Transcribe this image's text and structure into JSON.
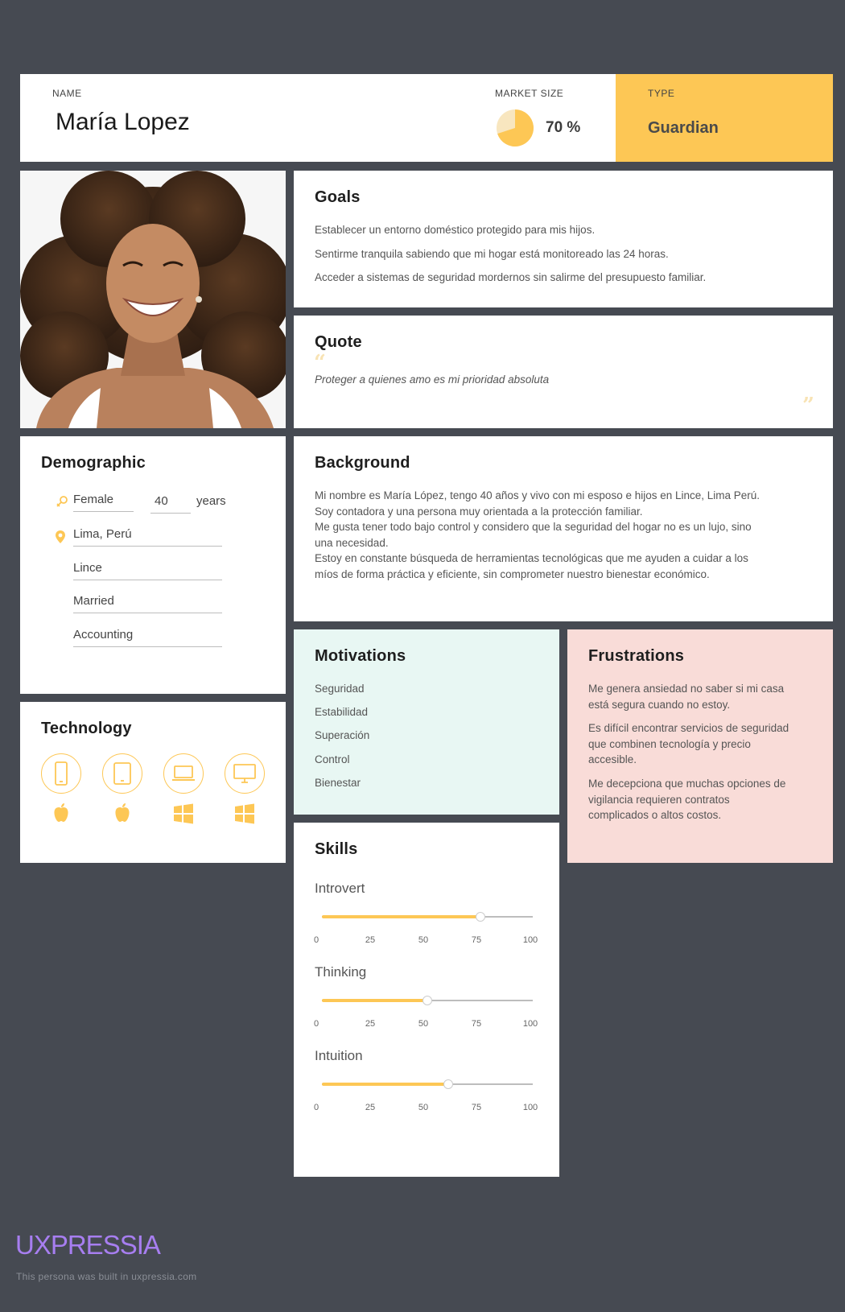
{
  "header": {
    "name_label": "NAME",
    "name": "María Lopez",
    "market_label": "MARKET SIZE",
    "market_value": "70 %",
    "market_fraction": 0.7,
    "type_label": "TYPE",
    "type_value": "Guardian"
  },
  "goals": {
    "title": "Goals",
    "items": [
      "Establecer un entorno doméstico protegido para mis hijos.",
      "Sentirme tranquila sabiendo que mi hogar está monitoreado las 24 horas.",
      "Acceder a sistemas de seguridad mordernos sin salirme del presupuesto familiar."
    ]
  },
  "quote": {
    "title": "Quote",
    "text": "Proteger a quienes amo es mi prioridad absoluta"
  },
  "demographic": {
    "title": "Demographic",
    "gender": "Female",
    "age": "40",
    "age_unit": "years",
    "location": "Lima, Perú",
    "district": "Lince",
    "status": "Married",
    "occupation": "Accounting"
  },
  "background": {
    "title": "Background",
    "lines": [
      "Mi nombre es María López, tengo 40 años y vivo con mi esposo e hijos en Lince, Lima Perú.",
      "Soy contadora y una persona muy orientada a la protección familiar.",
      "Me gusta tener todo bajo control y considero que la seguridad del hogar no es un lujo, sino",
      "una necesidad.",
      "Estoy en constante búsqueda de herramientas tecnológicas que me ayuden a cuidar a los",
      "míos de forma práctica y eficiente, sin comprometer nuestro bienestar económico."
    ]
  },
  "technology": {
    "title": "Technology",
    "devices": [
      {
        "icon": "smartphone-icon",
        "os": "apple-icon"
      },
      {
        "icon": "tablet-icon",
        "os": "apple-icon"
      },
      {
        "icon": "laptop-icon",
        "os": "windows-icon"
      },
      {
        "icon": "desktop-icon",
        "os": "windows-icon"
      }
    ]
  },
  "motivations": {
    "title": "Motivations",
    "items": [
      "Seguridad",
      "Estabilidad",
      "Superación",
      "Control",
      "Bienestar"
    ]
  },
  "frustrations": {
    "title": "Frustrations",
    "items": [
      [
        "Me genera ansiedad no saber si mi casa",
        "está segura cuando no estoy."
      ],
      [
        "Es difícil encontrar servicios de seguridad",
        "que combinen tecnología y precio",
        "accesible."
      ],
      [
        "Me decepciona que muchas opciones de",
        "vigilancia requieren contratos",
        "complicados o altos costos."
      ]
    ]
  },
  "skills": {
    "title": "Skills",
    "ticks": [
      "0",
      "25",
      "50",
      "75",
      "100"
    ],
    "items": [
      {
        "label": "Introvert",
        "value": 75
      },
      {
        "label": "Thinking",
        "value": 50
      },
      {
        "label": "Intuition",
        "value": 60
      }
    ]
  },
  "footer": {
    "brand": "UXPRESSIA",
    "note": "This persona was built in uxpressia.com"
  },
  "colors": {
    "accent": "#fdc755",
    "motivations_bg": "#e8f7f3",
    "frustrations_bg": "#f9dcd8",
    "brand": "#a77ef0",
    "page_bg": "#464a52"
  }
}
